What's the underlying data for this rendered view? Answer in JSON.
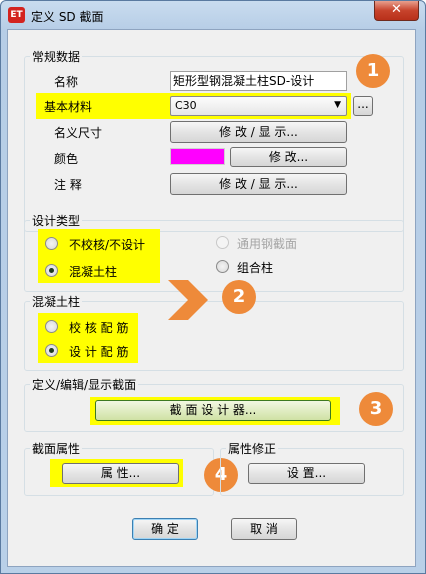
{
  "window": {
    "title": "定义 SD 截面",
    "app_icon": "ET",
    "close_glyph": "✕"
  },
  "general": {
    "title": "常规数据",
    "name_label": "名称",
    "name_value": "矩形型钢混凝土柱SD-设计",
    "material_label": "基本材料",
    "material_value": "C30",
    "material_browse": "...",
    "dimensions_label": "名义尺寸",
    "dimensions_button": "修 改 / 显 示...",
    "color_label": "颜色",
    "color_value": "#ff00ff",
    "color_button": "修 改...",
    "notes_label": "注 释",
    "notes_button": "修 改 / 显 示..."
  },
  "design_type": {
    "title": "设计类型",
    "options": [
      {
        "label": "不校核/不设计",
        "selected": false,
        "enabled": true
      },
      {
        "label": "混凝土柱",
        "selected": true,
        "enabled": true
      },
      {
        "label": "通用钢截面",
        "selected": false,
        "enabled": false
      },
      {
        "label": "组合柱",
        "selected": false,
        "enabled": true
      }
    ]
  },
  "concrete_column": {
    "title": "混凝土柱",
    "options": [
      {
        "label": "校 核 配 筋",
        "selected": false
      },
      {
        "label": "设 计 配 筋",
        "selected": true
      }
    ]
  },
  "define_section": {
    "title": "定义/编辑/显示截面",
    "button": "截 面 设 计 器..."
  },
  "section_properties": {
    "title": "截面属性",
    "button": "属 性..."
  },
  "property_modifiers": {
    "title": "属性修正",
    "button": "设 置..."
  },
  "footer": {
    "ok": "确 定",
    "cancel": "取 消"
  },
  "callouts": [
    "1",
    "2",
    "3",
    "4"
  ],
  "colors": {
    "highlight": "#ffff00",
    "callout": "#ee8a3a"
  }
}
